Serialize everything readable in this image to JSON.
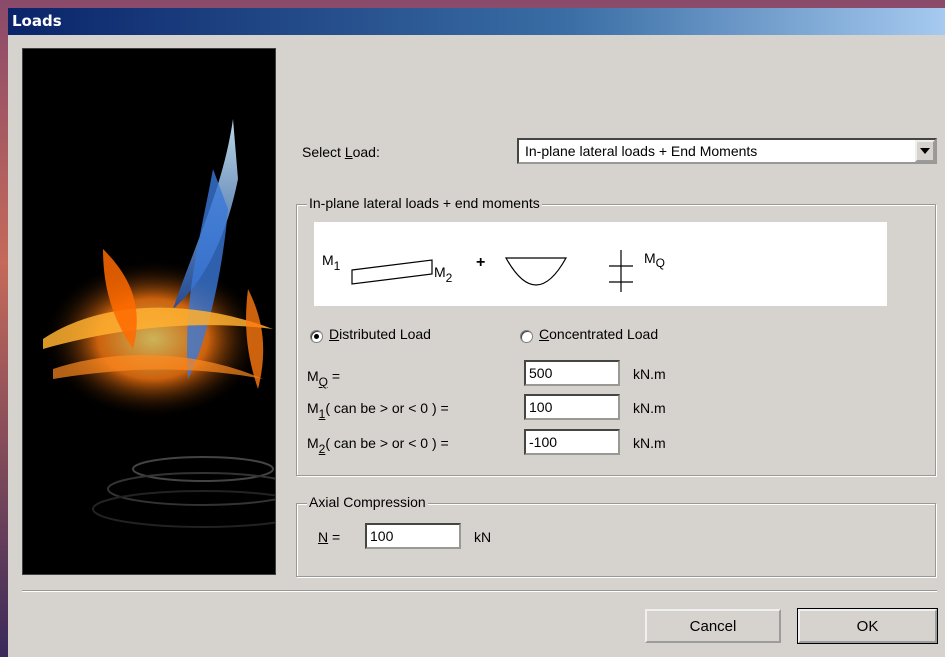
{
  "window": {
    "title": "Loads"
  },
  "select_load": {
    "label_pre": "Select ",
    "label_key": "L",
    "label_post": "oad:",
    "value": "In-plane lateral loads + End Moments"
  },
  "group_moments": {
    "caption": "In-plane lateral loads + end moments",
    "diagram": {
      "m1": "M",
      "m1_sub": "1",
      "m2": "M",
      "m2_sub": "2",
      "plus": "+",
      "mq": "M",
      "mq_sub": "Q"
    },
    "radio_distributed": {
      "key": "D",
      "rest": "istributed Load",
      "selected": true
    },
    "radio_concentrated": {
      "key": "C",
      "rest": "oncentrated Load",
      "selected": false
    },
    "mq": {
      "label": "M",
      "sub": "Q",
      "post": " =",
      "value": "500",
      "unit": "kN.m"
    },
    "m1": {
      "label": "M",
      "sub": "1",
      "post": "( can be > or < 0 )  =",
      "value": "100",
      "unit": "kN.m"
    },
    "m2": {
      "label": "M",
      "sub": "2",
      "post": "( can be > or < 0 )  =",
      "value": "-100",
      "unit": "kN.m"
    }
  },
  "group_axial": {
    "caption": "Axial Compression",
    "n_key": "N",
    "n_post": " =",
    "value": "100",
    "unit": "kN"
  },
  "buttons": {
    "cancel": "Cancel",
    "ok": "OK"
  },
  "icons": {
    "dropdown": "chevron-down-icon",
    "art": "flame-artwork"
  },
  "colors": {
    "dialog_bg": "#d6d3ce",
    "title_start": "#0a246a",
    "title_end": "#a6caf0"
  }
}
